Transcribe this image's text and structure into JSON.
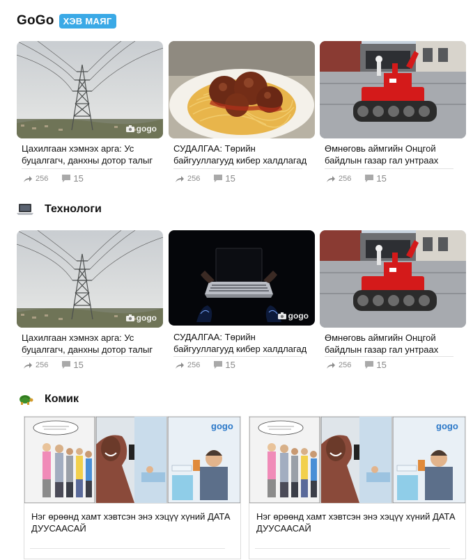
{
  "header": {
    "brand": "GoGo",
    "badge": "ХЭВ МАЯГ"
  },
  "watermark": "gogo",
  "row1": [
    {
      "title": "Цахилгаан хэмнэх арга: Ус буцалгагч, данхны дотор талыг",
      "shares": "256",
      "comments": "15"
    },
    {
      "title": "СУДАЛГАА: Төрийн байгууллагууд кибер халдлагад",
      "shares": "256",
      "comments": "15"
    },
    {
      "title": "Өмнөговь аймгийн Онцгой байдлын газар гал унтраах",
      "shares": "256",
      "comments": "15"
    }
  ],
  "tech": {
    "title": "Технологи"
  },
  "row2": [
    {
      "title": "Цахилгаан хэмнэх арга: Ус буцалгагч, данхны дотор талыг",
      "shares": "256",
      "comments": "15"
    },
    {
      "title": "СУДАЛГАА: Төрийн байгууллагууд кибер халдлагад",
      "shares": "256",
      "comments": "15"
    },
    {
      "title": "Өмнөговь аймгийн Онцгой байдлын газар гал унтраах",
      "shares": "256",
      "comments": "15"
    }
  ],
  "comic": {
    "title": "Комик",
    "items": [
      {
        "title": "Нэг өрөөнд хамт хэвтсэн энэ хэцүү хүний ДАТА ДУУСААСАЙ"
      },
      {
        "title": "Нэг өрөөнд хамт хэвтсэн энэ хэцүү хүний ДАТА ДУУСААСАЙ"
      }
    ]
  }
}
